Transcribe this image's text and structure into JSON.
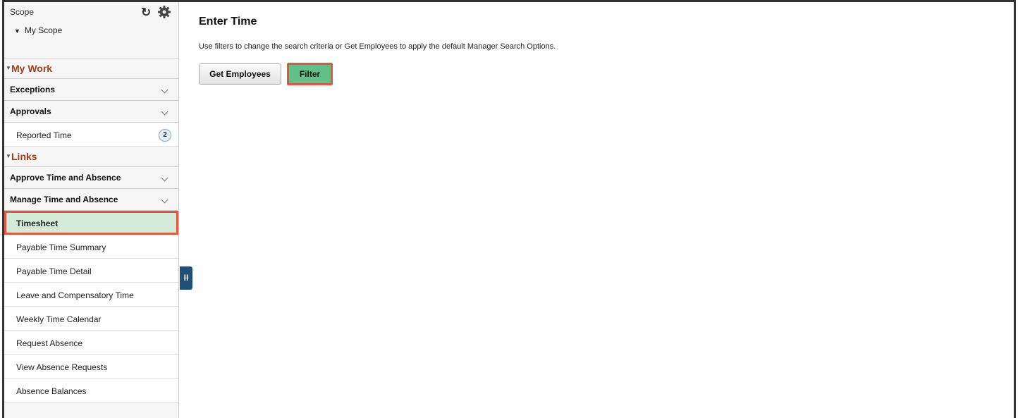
{
  "sidebar": {
    "scope_title": "Scope",
    "scope_item": "My Scope",
    "my_work": {
      "heading": "My Work",
      "sections": [
        {
          "label": "Exceptions"
        },
        {
          "label": "Approvals"
        }
      ],
      "items": [
        {
          "label": "Reported Time",
          "badge": "2"
        }
      ]
    },
    "links": {
      "heading": "Links",
      "sections": [
        {
          "label": "Approve Time and Absence"
        },
        {
          "label": "Manage Time and Absence"
        }
      ],
      "items": [
        {
          "label": "Timesheet",
          "selected": true
        },
        {
          "label": "Payable Time Summary"
        },
        {
          "label": "Payable Time Detail"
        },
        {
          "label": "Leave and Compensatory Time"
        },
        {
          "label": "Weekly Time Calendar"
        },
        {
          "label": "Request Absence"
        },
        {
          "label": "View Absence Requests"
        },
        {
          "label": "Absence Balances"
        }
      ]
    },
    "icons": [
      "refresh-icon",
      "gear-icon",
      "collapse-handle-icon",
      "chevron-down-icon"
    ]
  },
  "main": {
    "title": "Enter Time",
    "instructions": "Use filters to change the search criteria or Get Employees to apply the default Manager Search Options.",
    "buttons": {
      "get_employees": "Get Employees",
      "filter": "Filter"
    }
  },
  "colors": {
    "accent_heading": "#a0401a",
    "highlight_border": "#e4573f",
    "selected_bg": "#d3ecda",
    "filter_bg": "#63c088",
    "collapse_tab": "#1f4e79"
  }
}
